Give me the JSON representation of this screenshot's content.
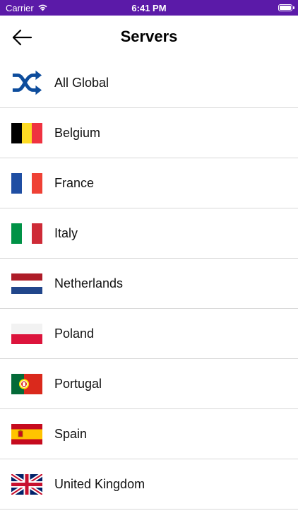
{
  "status_bar": {
    "carrier": "Carrier",
    "time": "6:41 PM"
  },
  "header": {
    "title": "Servers"
  },
  "servers": [
    {
      "label": "All Global",
      "icon": "shuffle-icon"
    },
    {
      "label": "Belgium",
      "icon": "belgium-flag-icon"
    },
    {
      "label": "France",
      "icon": "france-flag-icon"
    },
    {
      "label": "Italy",
      "icon": "italy-flag-icon"
    },
    {
      "label": "Netherlands",
      "icon": "netherlands-flag-icon"
    },
    {
      "label": "Poland",
      "icon": "poland-flag-icon"
    },
    {
      "label": "Portugal",
      "icon": "portugal-flag-icon"
    },
    {
      "label": "Spain",
      "icon": "spain-flag-icon"
    },
    {
      "label": "United Kingdom",
      "icon": "uk-flag-icon"
    }
  ],
  "colors": {
    "status_bar": "#5b1aa8",
    "shuffle_icon": "#0d4c9c"
  }
}
